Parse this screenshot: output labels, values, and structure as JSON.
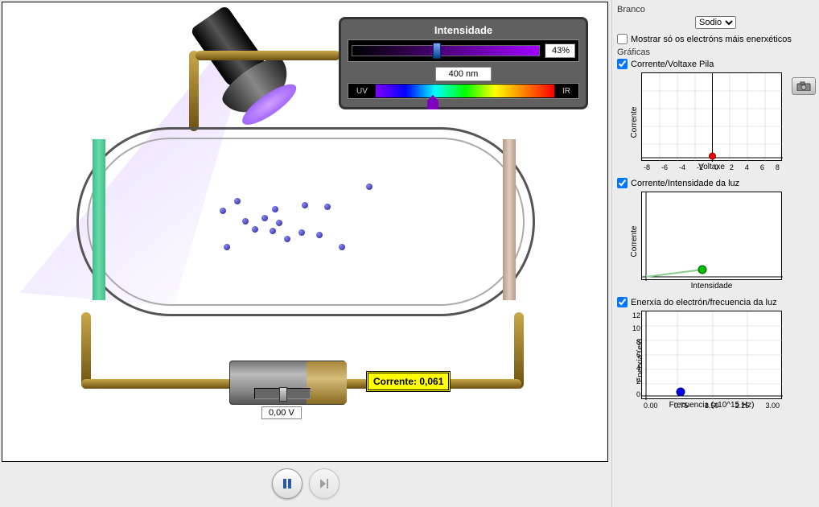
{
  "panel": {
    "intensity_title": "Intensidade",
    "intensity_value": "43%",
    "wavelength_value": "400 nm",
    "uv_label": "UV",
    "ir_label": "IR"
  },
  "battery": {
    "voltage_label": "0,00 V"
  },
  "current": {
    "label": "Corrente: ",
    "value": "0,061"
  },
  "side": {
    "target_label": "Branco",
    "target_selected": "Sodio",
    "only_highest_label": "Mostrar só os electróns máis enerxéticos",
    "graphs_title": "Gráficas",
    "graph1": {
      "title": "Corrente/Voltaxe Pila",
      "ylabel": "Corrente",
      "xlabel": "Voltaxe",
      "xticks": [
        "-8",
        "-6",
        "-4",
        "-2",
        "0",
        "2",
        "4",
        "6",
        "8"
      ]
    },
    "graph2": {
      "title": "Corrente/Intensidade da luz",
      "ylabel": "Corrente",
      "xlabel": "Intensidade"
    },
    "graph3": {
      "title": "Enerxía do electrón/frecuencia da luz",
      "ylabel": "Enerxía (ev)",
      "xlabel": "Frecuencia (x10^15 Hz)",
      "xticks": [
        "0.00",
        "0.75",
        "1.50",
        "2.25",
        "3.00"
      ],
      "yticks": [
        "12",
        "10",
        "8",
        "6",
        "4",
        "2",
        "0"
      ]
    }
  },
  "chart_data": [
    {
      "type": "scatter",
      "title": "Corrente/Voltaxe Pila",
      "xlabel": "Voltaxe",
      "ylabel": "Corrente",
      "xlim": [
        -8,
        8
      ],
      "series": [
        {
          "name": "point",
          "x": [
            0
          ],
          "y": [
            0.061
          ],
          "color": "#e00000"
        }
      ]
    },
    {
      "type": "line",
      "title": "Corrente/Intensidade da luz",
      "xlabel": "Intensidade",
      "ylabel": "Corrente",
      "series": [
        {
          "name": "trace",
          "x": [
            0,
            43
          ],
          "y": [
            0,
            0.061
          ],
          "color": "#00b000"
        }
      ]
    },
    {
      "type": "scatter",
      "title": "Enerxía do electrón/frecuencia da luz",
      "xlabel": "Frecuencia (x10^15 Hz)",
      "ylabel": "Enerxía (ev)",
      "xlim": [
        0,
        3.0
      ],
      "ylim": [
        0,
        12
      ],
      "series": [
        {
          "name": "point",
          "x": [
            0.75
          ],
          "y": [
            0.7
          ],
          "color": "#0000e0"
        }
      ]
    }
  ]
}
